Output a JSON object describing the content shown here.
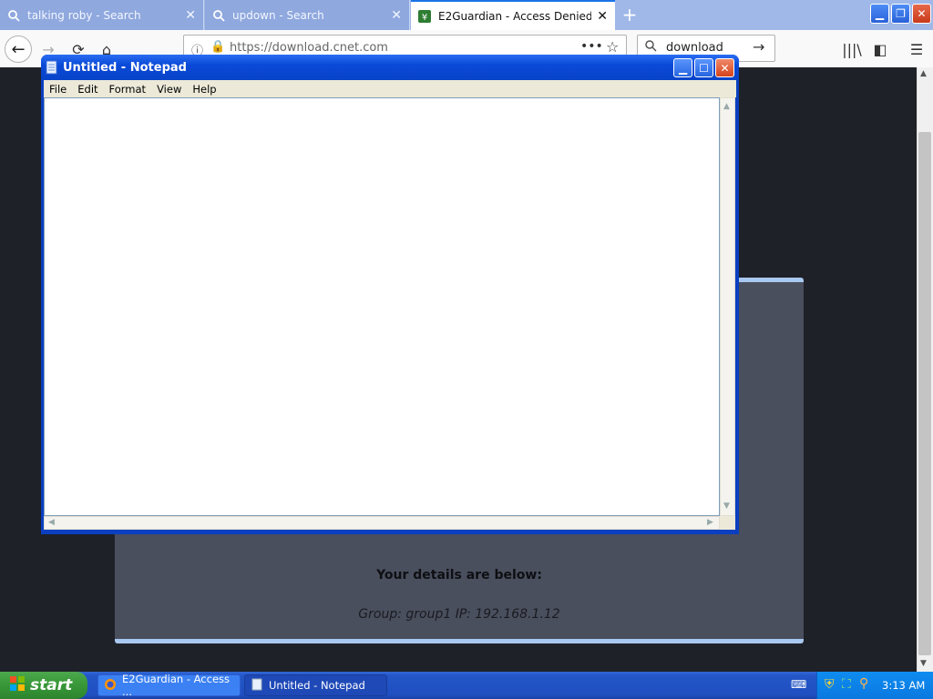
{
  "browser": {
    "tabs": [
      {
        "label": "talking roby - Search",
        "icon": "search-icon"
      },
      {
        "label": "updown - Search",
        "icon": "search-icon"
      },
      {
        "label": "E2Guardian - Access Denied",
        "icon": "e2guardian-favicon",
        "active": true
      }
    ],
    "new_tab": "+",
    "url": "https://download.cnet.com",
    "search": "download"
  },
  "page": {
    "details_heading": "Your details are below:",
    "details_line": "Group: group1   IP: 192.168.1.12"
  },
  "notepad": {
    "title": "Untitled - Notepad",
    "menu": [
      "File",
      "Edit",
      "Format",
      "View",
      "Help"
    ],
    "content": ""
  },
  "taskbar": {
    "start": "start",
    "tasks": [
      {
        "label": "E2Guardian - Access ..."
      },
      {
        "label": "Untitled - Notepad"
      }
    ],
    "clock": "3:13 AM"
  },
  "colors": {
    "xp_blue": "#0a4ad8",
    "start_green": "#3a9a3a",
    "tab_active_accent": "#1a73e8",
    "card_border": "#a8c8f0"
  }
}
